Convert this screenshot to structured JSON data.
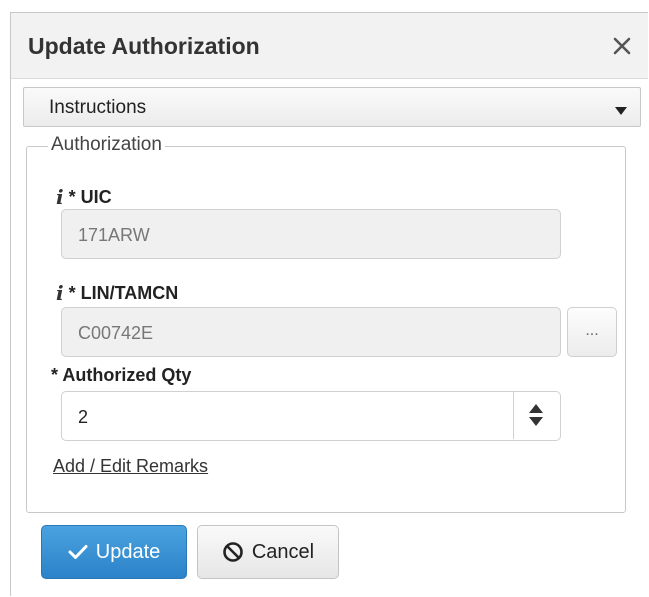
{
  "dialog": {
    "title": "Update Authorization",
    "close_icon": "close-icon"
  },
  "instructions": {
    "label": "Instructions",
    "icon": "caret-down-icon"
  },
  "authorization": {
    "legend": "Authorization",
    "uic": {
      "label": "* UIC",
      "value": "171ARW",
      "info_icon": "i"
    },
    "lin": {
      "label": "* LIN/TAMCN",
      "value": "C00742E",
      "info_icon": "i",
      "lookup_label": "..."
    },
    "qty": {
      "label": "* Authorized Qty",
      "value": "2",
      "spinner_icon": "sort-icon"
    },
    "remarks_link": "Add / Edit Remarks"
  },
  "actions": {
    "update_label": "Update",
    "cancel_label": "Cancel"
  },
  "colors": {
    "primary": "#2b82c9",
    "titlebar_bg": "#f2f2f2",
    "disabled_bg": "#f0f0f0"
  }
}
